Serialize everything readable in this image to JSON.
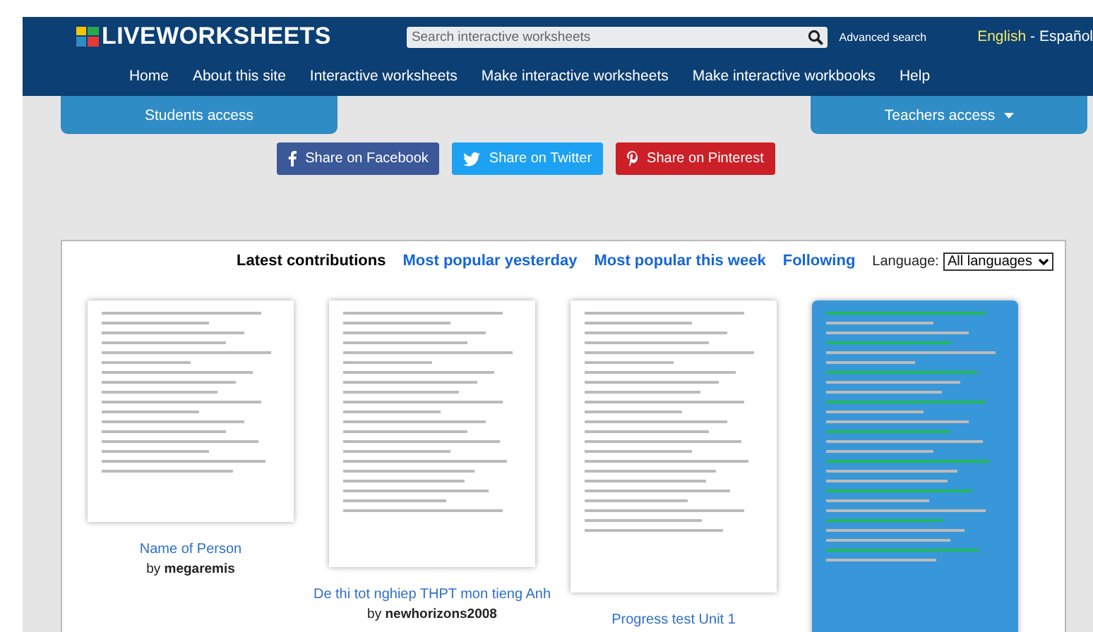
{
  "header": {
    "logo": "LIVEWORKSHEETS",
    "search": {
      "placeholder": "Search interactive worksheets"
    },
    "advanced_search": "Advanced search",
    "languages": [
      {
        "label": "English",
        "selected": true
      },
      {
        "label": "Español",
        "selected": false
      }
    ],
    "separator": "-"
  },
  "nav": [
    "Home",
    "About this site",
    "Interactive worksheets",
    "Make interactive worksheets",
    "Make interactive workbooks",
    "Help"
  ],
  "access": [
    {
      "label": "Students access",
      "dropdown": false
    },
    {
      "label": "Teachers access",
      "dropdown": true
    }
  ],
  "share": [
    {
      "kind": "facebook",
      "label": "Share on Facebook",
      "color": "#3b5998"
    },
    {
      "kind": "twitter",
      "label": "Share on Twitter",
      "color": "#1da1f2"
    },
    {
      "kind": "pinterest",
      "label": "Share on Pinterest",
      "color": "#cb2027"
    }
  ],
  "tabs": [
    {
      "label": "Latest contributions",
      "selected": true
    },
    {
      "label": "Most popular yesterday",
      "selected": false
    },
    {
      "label": "Most popular this week",
      "selected": false
    },
    {
      "label": "Following",
      "selected": false
    }
  ],
  "language_filter": {
    "label": "Language:",
    "value": "All languages"
  },
  "worksheets": [
    {
      "kind": "pictures",
      "title": "Name of Person",
      "by": "by",
      "author": "megaremis"
    },
    {
      "kind": "text",
      "title": "De thi tot nghiep THPT mon tieng Anh",
      "by": "by",
      "author": "newhorizons2008"
    },
    {
      "kind": "test",
      "title": "Progress test Unit 1"
    },
    {
      "kind": "blue"
    }
  ]
}
